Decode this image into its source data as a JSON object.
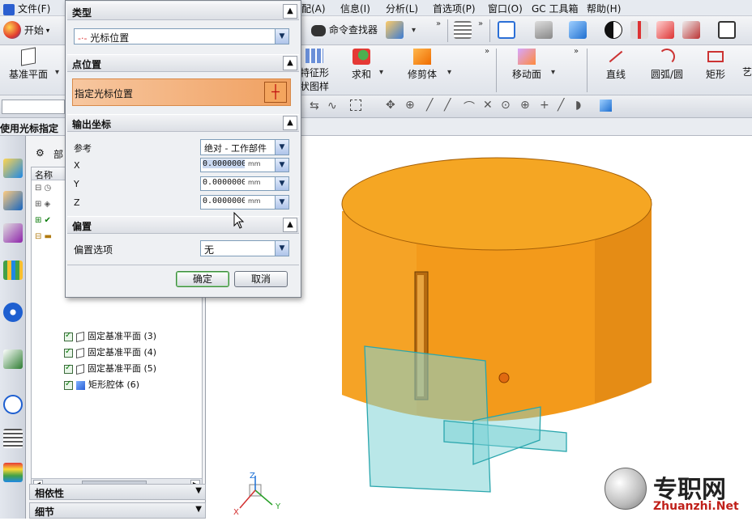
{
  "menubar": {
    "file": "文件(F)",
    "assembly": "装配(A)",
    "info": "信息(I)",
    "analysis": "分析(L)",
    "preferences": "首选项(P)",
    "window": "窗口(O)",
    "gc_toolkit": "GC 工具箱",
    "help": "帮助(H)"
  },
  "toolbar1": {
    "start": "开始",
    "command_finder": "命令查找器"
  },
  "toolbar2": {
    "datum_plane": "基准平面",
    "feature_pattern_line1": "特征形",
    "feature_pattern_line2": "状图样",
    "unite": "求和",
    "trim_body": "修剪体",
    "move_face": "移动面",
    "line": "直线",
    "arc_circle": "圆弧/圆",
    "rectangle": "矩形",
    "art": "艺"
  },
  "cue_line": "使用光标指定",
  "navigator": {
    "col_name": "名称",
    "col_extra": "部",
    "items": [
      {
        "label": "固定基准平面 (3)"
      },
      {
        "label": "固定基准平面 (4)"
      },
      {
        "label": "固定基准平面 (5)"
      },
      {
        "label": "矩形腔体 (6)"
      }
    ],
    "dependencies": "相依性",
    "details": "细节"
  },
  "dialog": {
    "type_title": "类型",
    "type_value": "光标位置",
    "point_title": "点位置",
    "point_specify": "指定光标位置",
    "output_title": "输出坐标",
    "ref_label": "参考",
    "ref_value": "绝对 - 工作部件",
    "x_label": "X",
    "y_label": "Y",
    "z_label": "Z",
    "x_value": "0.0000000",
    "y_value": "0.0000000",
    "z_value": "0.0000000",
    "unit": "mm",
    "offset_title": "偏置",
    "offset_option_label": "偏置选项",
    "offset_option_value": "无",
    "ok": "确定",
    "cancel": "取消"
  },
  "triad": {
    "x": "X",
    "y": "Y",
    "z": "Z"
  },
  "watermark": {
    "title": "专职网",
    "url": "Zhuanzhi.Net"
  },
  "colors": {
    "cylinder": "#f39a1b",
    "cylinder_top": "#f5a623",
    "plane_fill": "#7fd3d6",
    "plane_edge": "#2aa6ad",
    "accent_orange": "#f0a060"
  }
}
